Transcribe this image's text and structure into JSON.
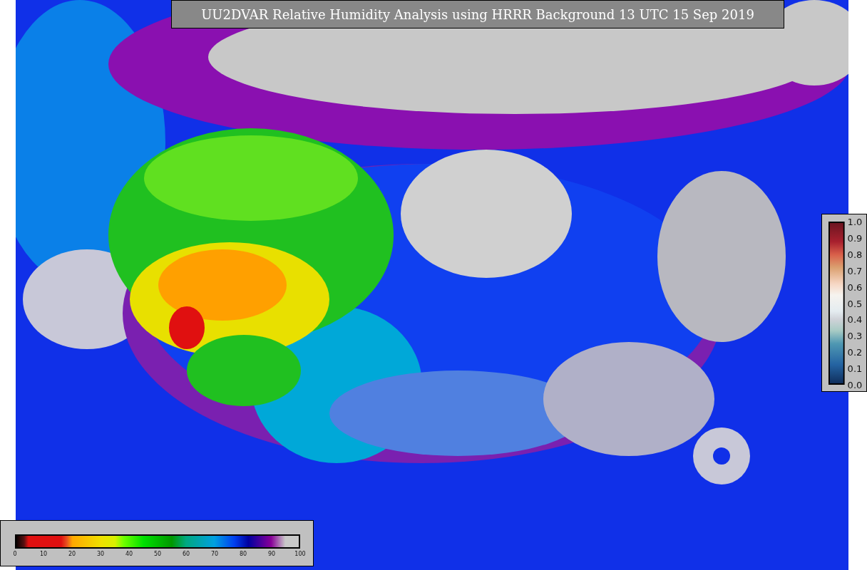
{
  "title": "UU2DVAR Relative Humidity Analysis using HRRR Background 13 UTC 15 Sep 2019",
  "humidity_colorbar": {
    "ticks": [
      "0",
      "10",
      "20",
      "30",
      "40",
      "50",
      "60",
      "70",
      "80",
      "90",
      "100"
    ]
  },
  "weight_colorbar": {
    "ticks": [
      "1.0",
      "0.9",
      "0.8",
      "0.7",
      "0.6",
      "0.5",
      "0.4",
      "0.3",
      "0.2",
      "0.1",
      "0.0"
    ]
  }
}
